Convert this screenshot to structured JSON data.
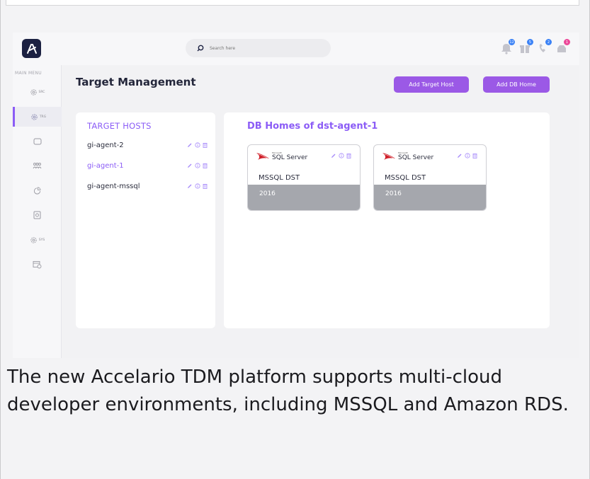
{
  "app": {
    "search_placeholder": "Search here",
    "menu_label": "MAIN MENU",
    "sidebar": [
      {
        "icon": "gear-icon",
        "label": "SRC"
      },
      {
        "icon": "gear-icon",
        "label": "TRG",
        "active": true
      },
      {
        "icon": "rectangle-icon",
        "label": ""
      },
      {
        "icon": "users-icon",
        "label": ""
      },
      {
        "icon": "pie-chart-icon",
        "label": ""
      },
      {
        "icon": "database-icon",
        "label": ""
      },
      {
        "icon": "gear-icon",
        "label": "SYS"
      },
      {
        "icon": "calendar-icon",
        "label": ""
      }
    ],
    "notifications": [
      {
        "icon": "bell-icon",
        "count": "12",
        "color": "#3b82f6"
      },
      {
        "icon": "gift-icon",
        "count": "5",
        "color": "#3b82f6"
      },
      {
        "icon": "phone-icon",
        "count": "2",
        "color": "#3b82f6"
      },
      {
        "icon": "inbox-icon",
        "count": "1",
        "color": "#ec4899"
      }
    ]
  },
  "page": {
    "title": "Target Management",
    "add_target_host": "Add Target Host",
    "add_db_home": "Add DB Home"
  },
  "hosts": {
    "title": "TARGET HOSTS",
    "items": [
      {
        "name": "gi-agent-2",
        "selected": false
      },
      {
        "name": "gi-agent-1",
        "selected": true
      },
      {
        "name": "gi-agent-mssql",
        "selected": false
      }
    ]
  },
  "db_homes": {
    "title": "DB Homes of dst-agent-1",
    "cards": [
      {
        "product": "SQL Server",
        "maker": "Microsoft",
        "name": "MSSQL DST",
        "version": "2016"
      },
      {
        "product": "SQL Server",
        "maker": "Microsoft",
        "name": "MSSQL DST",
        "version": "2016"
      }
    ]
  },
  "caption": "The new Accelario TDM platform supports multi-cloud developer environments, including MSSQL and Amazon RDS.",
  "colors": {
    "accent": "#8b5cf6",
    "button": "#9b59e6",
    "logo_bg": "#1c2142"
  }
}
